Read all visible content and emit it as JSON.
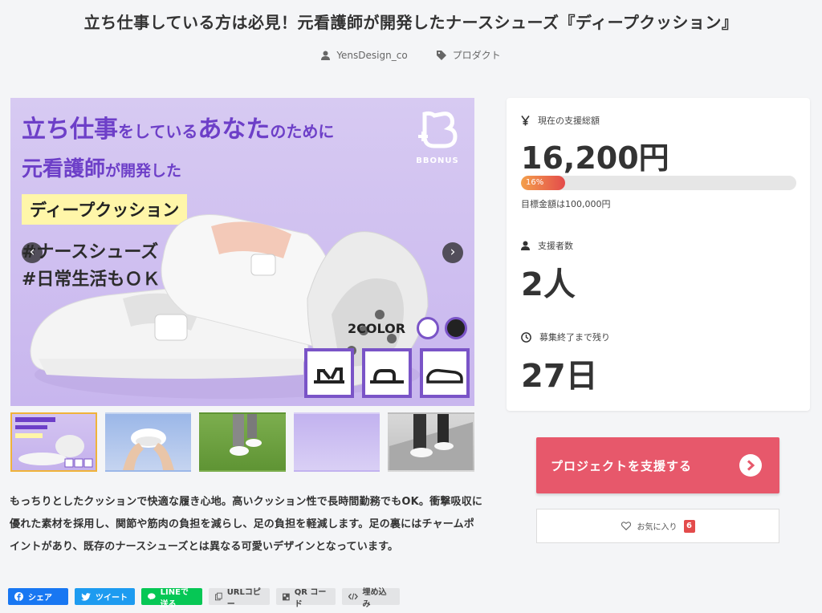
{
  "page": {
    "title": "立ち仕事している方は必見！元看護師が開発したナースシューズ『ディープクッション』",
    "author": "YensDesign_co",
    "category": "プロダクト"
  },
  "hero": {
    "line1_a": "立ち仕事",
    "line1_b": "をしている",
    "line1_c": "あなた",
    "line1_d": "のために",
    "line2_a": "元看護師",
    "line2_b": "が開発した",
    "highlight": "ディープクッション",
    "tag1": "#ナースシューズ",
    "tag2": "#日常生活もＯＫ",
    "brand": "BBONUS",
    "color_label": "2COLOR",
    "prev": "‹",
    "next": "›"
  },
  "stats": {
    "amount_label": "現在の支援総額",
    "amount": "16,200円",
    "progress_text": "16%",
    "progress_ratio": 0.16,
    "goal": "目標金額は100,000円",
    "backers_label": "支援者数",
    "backers": "2人",
    "remaining_label": "募集終了まで残り",
    "remaining": "27日"
  },
  "description": "もっちりとしたクッションで快適な履き心地。高いクッション性で長時間勤務でもOK。衝撃吸収に優れた素材を採用し、関節や筋肉の負担を減らし、足の負担を軽減します。足の裏にはチャームポイントがあり、既存のナースシューズとは異なる可愛いデザインとなっています。",
  "actions": {
    "support": "プロジェクトを支援する",
    "favorite": "お気に入り",
    "favorite_count": "6"
  },
  "share": {
    "facebook": "シェア",
    "twitter": "ツイート",
    "line": "LINEで送る",
    "url_copy": "URLコピー",
    "qr": "QR コード",
    "embed": "埋め込み"
  },
  "colors": {
    "accent": "#e7586b",
    "hero_purple": "#6d3fc8",
    "progress_start": "#f4a04b",
    "progress_end": "#e34b4b"
  }
}
